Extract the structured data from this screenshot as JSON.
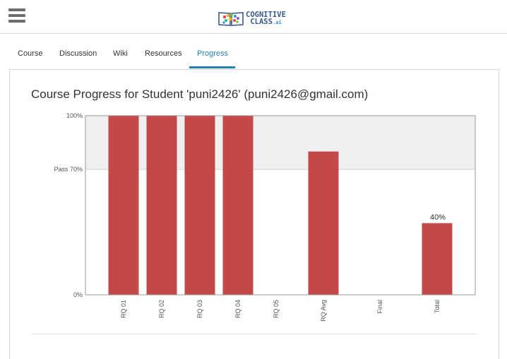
{
  "header": {
    "logo": {
      "line1": "COGNITIVE",
      "line2": "CLASS",
      "line2_suffix": ".ai"
    },
    "menu_icon": "hamburger-menu-icon"
  },
  "tabs": [
    {
      "label": "Course",
      "active": false
    },
    {
      "label": "Discussion",
      "active": false
    },
    {
      "label": "Wiki",
      "active": false
    },
    {
      "label": "Resources",
      "active": false
    },
    {
      "label": "Progress",
      "active": true
    }
  ],
  "page": {
    "title": "Course Progress for Student 'puni2426' (puni2426@gmail.com)"
  },
  "colors": {
    "bar": "#c44848",
    "accent": "#1f7fb5",
    "pass_band": "#efefef"
  },
  "chart_data": {
    "type": "bar",
    "categories": [
      "RQ 01",
      "RQ 02",
      "RQ 03",
      "RQ 04",
      "RQ 05",
      "RQ Avg",
      "Final",
      "Total"
    ],
    "values": [
      100,
      100,
      100,
      100,
      0,
      80,
      0,
      40
    ],
    "data_labels": {
      "Total": "40%"
    },
    "y_ticks": [
      {
        "value": 0,
        "label": "0%"
      },
      {
        "value": 70,
        "label": "Pass 70%"
      },
      {
        "value": 100,
        "label": "100%"
      }
    ],
    "pass_threshold": 70,
    "ylim": [
      0,
      100
    ],
    "title": "",
    "xlabel": "",
    "ylabel": ""
  }
}
